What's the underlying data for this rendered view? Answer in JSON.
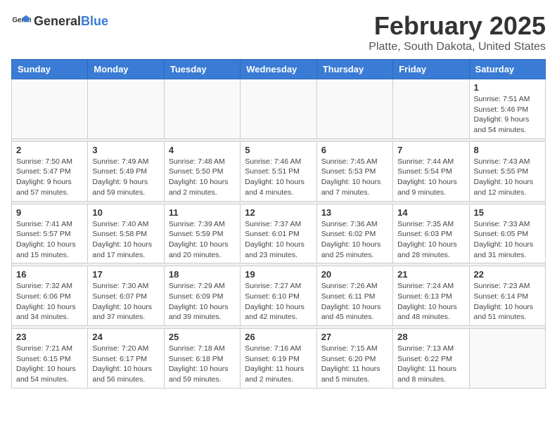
{
  "header": {
    "logo_general": "General",
    "logo_blue": "Blue",
    "month_title": "February 2025",
    "location": "Platte, South Dakota, United States"
  },
  "weekdays": [
    "Sunday",
    "Monday",
    "Tuesday",
    "Wednesday",
    "Thursday",
    "Friday",
    "Saturday"
  ],
  "weeks": [
    [
      {
        "day": "",
        "info": ""
      },
      {
        "day": "",
        "info": ""
      },
      {
        "day": "",
        "info": ""
      },
      {
        "day": "",
        "info": ""
      },
      {
        "day": "",
        "info": ""
      },
      {
        "day": "",
        "info": ""
      },
      {
        "day": "1",
        "info": "Sunrise: 7:51 AM\nSunset: 5:46 PM\nDaylight: 9 hours and 54 minutes."
      }
    ],
    [
      {
        "day": "2",
        "info": "Sunrise: 7:50 AM\nSunset: 5:47 PM\nDaylight: 9 hours and 57 minutes."
      },
      {
        "day": "3",
        "info": "Sunrise: 7:49 AM\nSunset: 5:49 PM\nDaylight: 9 hours and 59 minutes."
      },
      {
        "day": "4",
        "info": "Sunrise: 7:48 AM\nSunset: 5:50 PM\nDaylight: 10 hours and 2 minutes."
      },
      {
        "day": "5",
        "info": "Sunrise: 7:46 AM\nSunset: 5:51 PM\nDaylight: 10 hours and 4 minutes."
      },
      {
        "day": "6",
        "info": "Sunrise: 7:45 AM\nSunset: 5:53 PM\nDaylight: 10 hours and 7 minutes."
      },
      {
        "day": "7",
        "info": "Sunrise: 7:44 AM\nSunset: 5:54 PM\nDaylight: 10 hours and 9 minutes."
      },
      {
        "day": "8",
        "info": "Sunrise: 7:43 AM\nSunset: 5:55 PM\nDaylight: 10 hours and 12 minutes."
      }
    ],
    [
      {
        "day": "9",
        "info": "Sunrise: 7:41 AM\nSunset: 5:57 PM\nDaylight: 10 hours and 15 minutes."
      },
      {
        "day": "10",
        "info": "Sunrise: 7:40 AM\nSunset: 5:58 PM\nDaylight: 10 hours and 17 minutes."
      },
      {
        "day": "11",
        "info": "Sunrise: 7:39 AM\nSunset: 5:59 PM\nDaylight: 10 hours and 20 minutes."
      },
      {
        "day": "12",
        "info": "Sunrise: 7:37 AM\nSunset: 6:01 PM\nDaylight: 10 hours and 23 minutes."
      },
      {
        "day": "13",
        "info": "Sunrise: 7:36 AM\nSunset: 6:02 PM\nDaylight: 10 hours and 25 minutes."
      },
      {
        "day": "14",
        "info": "Sunrise: 7:35 AM\nSunset: 6:03 PM\nDaylight: 10 hours and 28 minutes."
      },
      {
        "day": "15",
        "info": "Sunrise: 7:33 AM\nSunset: 6:05 PM\nDaylight: 10 hours and 31 minutes."
      }
    ],
    [
      {
        "day": "16",
        "info": "Sunrise: 7:32 AM\nSunset: 6:06 PM\nDaylight: 10 hours and 34 minutes."
      },
      {
        "day": "17",
        "info": "Sunrise: 7:30 AM\nSunset: 6:07 PM\nDaylight: 10 hours and 37 minutes."
      },
      {
        "day": "18",
        "info": "Sunrise: 7:29 AM\nSunset: 6:09 PM\nDaylight: 10 hours and 39 minutes."
      },
      {
        "day": "19",
        "info": "Sunrise: 7:27 AM\nSunset: 6:10 PM\nDaylight: 10 hours and 42 minutes."
      },
      {
        "day": "20",
        "info": "Sunrise: 7:26 AM\nSunset: 6:11 PM\nDaylight: 10 hours and 45 minutes."
      },
      {
        "day": "21",
        "info": "Sunrise: 7:24 AM\nSunset: 6:13 PM\nDaylight: 10 hours and 48 minutes."
      },
      {
        "day": "22",
        "info": "Sunrise: 7:23 AM\nSunset: 6:14 PM\nDaylight: 10 hours and 51 minutes."
      }
    ],
    [
      {
        "day": "23",
        "info": "Sunrise: 7:21 AM\nSunset: 6:15 PM\nDaylight: 10 hours and 54 minutes."
      },
      {
        "day": "24",
        "info": "Sunrise: 7:20 AM\nSunset: 6:17 PM\nDaylight: 10 hours and 56 minutes."
      },
      {
        "day": "25",
        "info": "Sunrise: 7:18 AM\nSunset: 6:18 PM\nDaylight: 10 hours and 59 minutes."
      },
      {
        "day": "26",
        "info": "Sunrise: 7:16 AM\nSunset: 6:19 PM\nDaylight: 11 hours and 2 minutes."
      },
      {
        "day": "27",
        "info": "Sunrise: 7:15 AM\nSunset: 6:20 PM\nDaylight: 11 hours and 5 minutes."
      },
      {
        "day": "28",
        "info": "Sunrise: 7:13 AM\nSunset: 6:22 PM\nDaylight: 11 hours and 8 minutes."
      },
      {
        "day": "",
        "info": ""
      }
    ]
  ]
}
